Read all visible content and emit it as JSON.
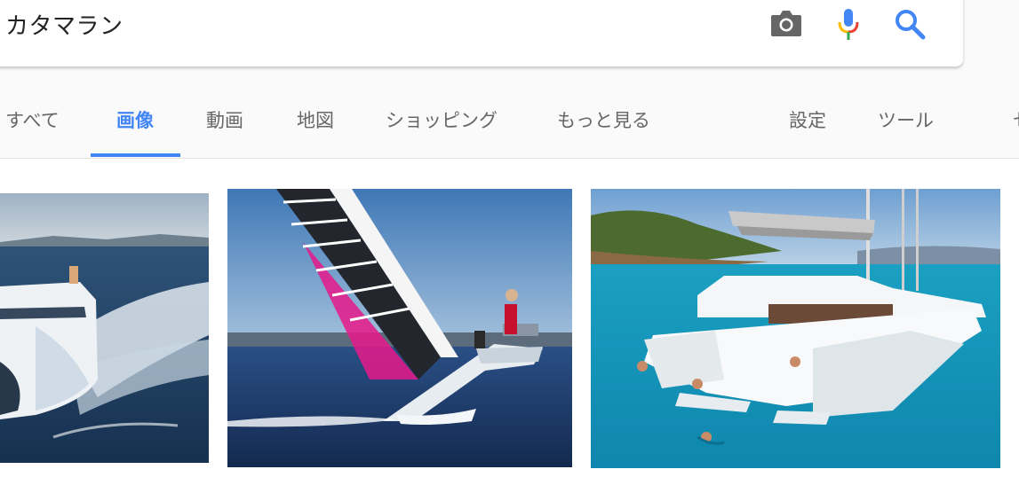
{
  "search": {
    "query": "カタマラン"
  },
  "tabs": [
    {
      "label": "すべて",
      "active": false
    },
    {
      "label": "画像",
      "active": true
    },
    {
      "label": "動画",
      "active": false
    },
    {
      "label": "地図",
      "active": false
    },
    {
      "label": "ショッピング",
      "active": false
    },
    {
      "label": "もっと見る",
      "active": false
    },
    {
      "label": "設定",
      "active": false
    },
    {
      "label": "ツール",
      "active": false
    },
    {
      "label": "セ",
      "active": false
    }
  ],
  "colors": {
    "accent": "#4285f4",
    "tab_text": "#666666",
    "mic_blue": "#4285f4",
    "mic_red": "#ea4335",
    "mic_yellow": "#fbbc05",
    "mic_green": "#34a853"
  },
  "icons": {
    "camera": "camera-icon",
    "microphone": "mic-icon",
    "search": "search-icon"
  },
  "results": [
    {
      "subject": "white catamaran ferry speeding on open sea"
    },
    {
      "subject": "sailing catamaran heeling with pink and black sail"
    },
    {
      "subject": "luxury sailing catamaran anchored in turquoise water"
    }
  ]
}
